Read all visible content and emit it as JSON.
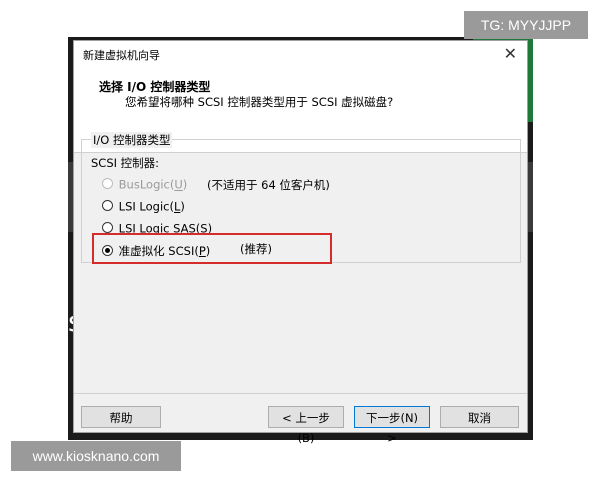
{
  "window": {
    "title": "新建虚拟机向导",
    "close_symbol": "✕"
  },
  "header": {
    "title": "选择 I/O 控制器类型",
    "subtitle": "您希望将哪种 SCSI 控制器类型用于 SCSI 虚拟磁盘?"
  },
  "group": {
    "legend": "I/O 控制器类型",
    "scsi_label": "SCSI 控制器:",
    "options": [
      {
        "label": "BusLogic(",
        "key": "U",
        "end": ")",
        "note": "(不适用于 64 位客户机)",
        "enabled": false,
        "selected": false
      },
      {
        "label": "LSI Logic(",
        "key": "L",
        "end": ")",
        "note": "",
        "enabled": true,
        "selected": false
      },
      {
        "label": "LSI Logic SAS(",
        "key": "S",
        "end": ")",
        "note": "",
        "enabled": true,
        "selected": false
      },
      {
        "label": "准虚拟化 SCSI(",
        "key": "P",
        "end": ")",
        "note": "(推荐)",
        "enabled": true,
        "selected": true
      }
    ]
  },
  "buttons": {
    "help": "帮助",
    "back": "< 上一步(B)",
    "next": "下一步(N) >",
    "cancel": "取消"
  },
  "highlight_color": "#d62b2b",
  "watermarks": {
    "tg": "TG: MYYJJPP",
    "site": "www.kiosknano.com"
  },
  "background": {
    "partial_text": "s"
  }
}
